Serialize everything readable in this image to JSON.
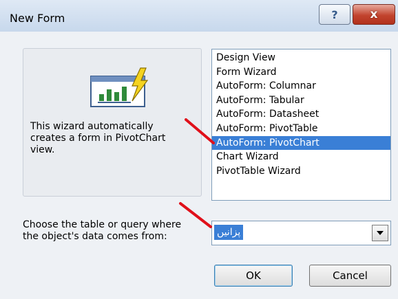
{
  "window": {
    "title": "New Form",
    "help_glyph": "?",
    "close_glyph": "x"
  },
  "preview": {
    "icon": "pivotchart-icon",
    "description": "This wizard automatically\ncreates a form in PivotChart\nview."
  },
  "list": {
    "items": [
      "Design View",
      "Form Wizard",
      "AutoForm:  Columnar",
      "AutoForm:  Tabular",
      "AutoForm:  Datasheet",
      "AutoForm:  PivotTable",
      "AutoForm:  PivotChart",
      "Chart Wizard",
      "PivotTable Wizard"
    ],
    "selected_index": 6
  },
  "source": {
    "label": "Choose the table or query where\nthe object's data comes from:",
    "value": "پزانیں"
  },
  "buttons": {
    "ok": "OK",
    "cancel": "Cancel"
  },
  "colors": {
    "selection": "#3a7fd6",
    "annotation": "#e0101a"
  }
}
